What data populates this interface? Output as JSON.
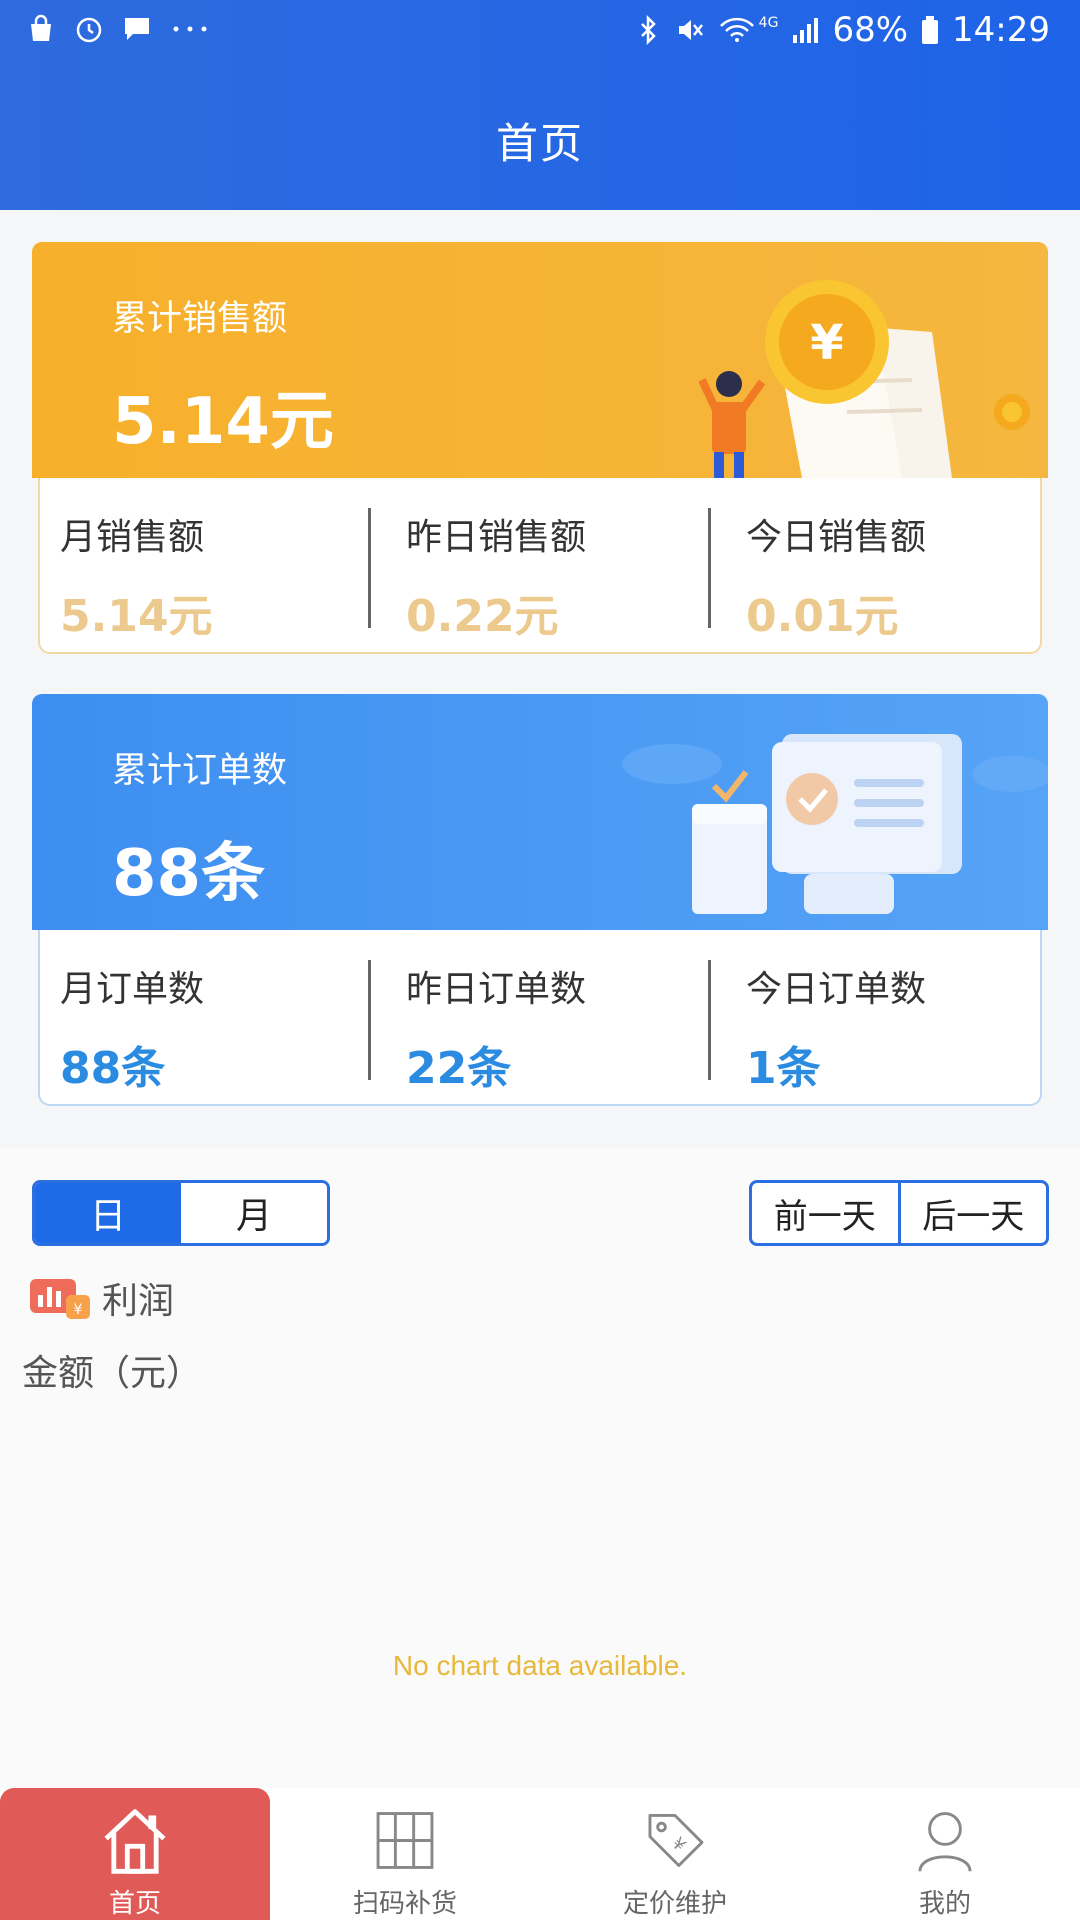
{
  "status_bar": {
    "battery": "68%",
    "time": "14:29",
    "network": "4G"
  },
  "header": {
    "title": "首页"
  },
  "sales_card": {
    "label": "累计销售额",
    "value": "5.14元",
    "stats": [
      {
        "label": "月销售额",
        "value": "5.14元"
      },
      {
        "label": "昨日销售额",
        "value": "0.22元"
      },
      {
        "label": "今日销售额",
        "value": "0.01元"
      }
    ]
  },
  "orders_card": {
    "label": "累计订单数",
    "value": "88条",
    "stats": [
      {
        "label": "月订单数",
        "value": "88条"
      },
      {
        "label": "昨日订单数",
        "value": "22条"
      },
      {
        "label": "今日订单数",
        "value": "1条"
      }
    ]
  },
  "chart_section": {
    "toggle": {
      "day": "日",
      "month": "月",
      "selected": "日"
    },
    "prev_day": "前一天",
    "next_day": "后一天",
    "legend": "利润",
    "unit_label": "金额（元）",
    "no_data": "No chart data available."
  },
  "tabbar": {
    "items": [
      {
        "label": "首页",
        "icon": "home-icon",
        "active": true
      },
      {
        "label": "扫码补货",
        "icon": "shelves-icon",
        "active": false
      },
      {
        "label": "定价维护",
        "icon": "price-tag-icon",
        "active": false
      },
      {
        "label": "我的",
        "icon": "user-icon",
        "active": false
      }
    ]
  },
  "colors": {
    "header_blue": "#1e63e8",
    "sales_orange": "#f7b02b",
    "orders_blue": "#3d8ef0",
    "active_tab_red": "#e05b57",
    "no_data_yellow": "#e8b83a"
  }
}
